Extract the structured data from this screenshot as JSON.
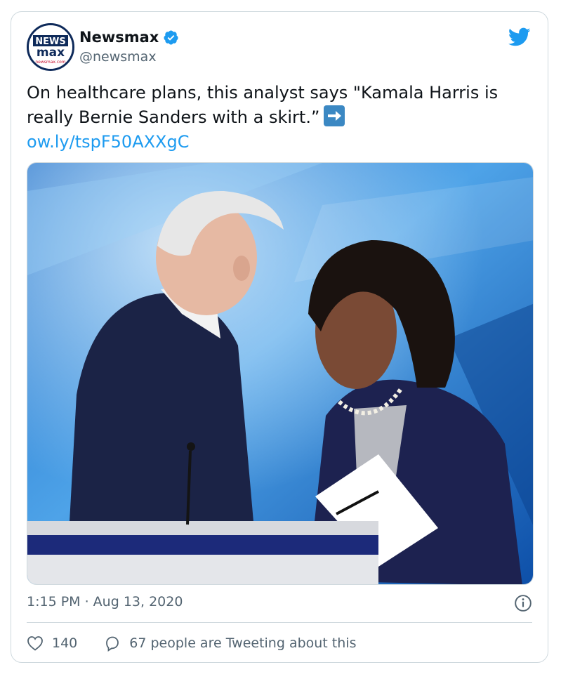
{
  "account": {
    "display_name": "Newsmax",
    "handle": "@newsmax",
    "avatar_text_top": "NEWS",
    "avatar_text_bottom": "max",
    "avatar_site": "newsmax.com"
  },
  "tweet": {
    "text": "On healthcare plans, this analyst says \"Kamala Harris is really Bernie Sanders with a skirt.”",
    "link": "ow.ly/tspF50AXXgC",
    "media_alt": "photo"
  },
  "meta": {
    "timestamp": "1:15 PM · Aug 13, 2020"
  },
  "actions": {
    "likes": "140",
    "tweeting": "67 people are Tweeting about this"
  },
  "colors": {
    "link": "#1d9bf0",
    "secondary_text": "#536471",
    "twitter_blue": "#1d9bf0",
    "border": "#cfd9de"
  },
  "icons": [
    "twitter-bird-icon",
    "verified-badge-icon",
    "right-arrow-emoji-icon",
    "info-icon",
    "heart-icon",
    "speech-bubble-icon"
  ]
}
